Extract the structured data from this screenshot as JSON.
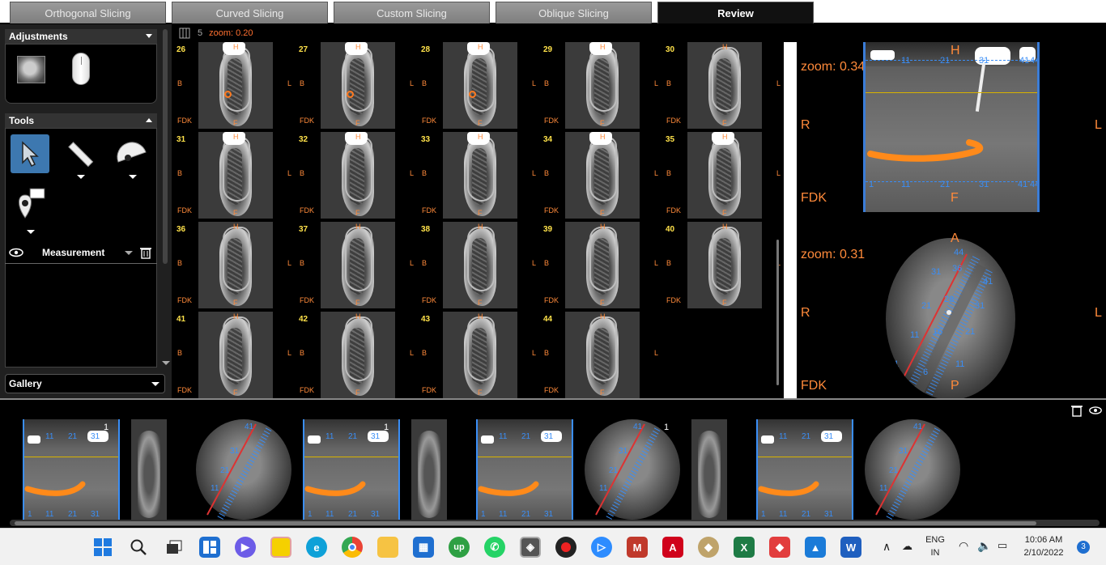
{
  "tabs": [
    {
      "label": "Orthogonal Slicing",
      "active": false
    },
    {
      "label": "Curved Slicing",
      "active": false
    },
    {
      "label": "Custom Slicing",
      "active": false
    },
    {
      "label": "Oblique Slicing",
      "active": false
    },
    {
      "label": "Review",
      "active": true
    }
  ],
  "left_panel": {
    "adjustments_title": "Adjustments",
    "tools_title": "Tools",
    "measurement_label": "Measurement",
    "gallery_label": "Gallery"
  },
  "grid": {
    "layout_count": "5",
    "zoom_label": "zoom: 0.20",
    "orientation_labels": {
      "top": "H",
      "bottom": "F",
      "left": "B",
      "right": "L",
      "corner": "FDK"
    },
    "slices": [
      "26",
      "27",
      "28",
      "29",
      "30",
      "31",
      "32",
      "33",
      "34",
      "35",
      "36",
      "37",
      "38",
      "39",
      "40",
      "41",
      "42",
      "43",
      "44"
    ]
  },
  "right_view": {
    "upper": {
      "zoom": "zoom: 0.34",
      "left": "R",
      "right": "L",
      "corner": "FDK",
      "top_marker": "H",
      "bottom_marker": "F",
      "top_ticks": [
        "1",
        "11",
        "21",
        "31",
        "41",
        "44"
      ],
      "bottom_ticks": [
        "1",
        "11",
        "21",
        "31",
        "41",
        "44"
      ]
    },
    "lower": {
      "zoom": "zoom: 0.31",
      "left": "R",
      "right": "L",
      "corner": "FDK",
      "top_marker": "A",
      "bottom_marker": "P",
      "ticks": [
        "44",
        "41",
        "31",
        "36",
        "21",
        "26",
        "11",
        "16",
        "1",
        "6",
        "1",
        "11",
        "21",
        "31",
        "41",
        "31"
      ]
    }
  },
  "gallery": {
    "items": [
      {
        "type": "pano"
      },
      {
        "type": "slice",
        "label": "1"
      },
      {
        "type": "axial"
      },
      {
        "type": "pano"
      },
      {
        "type": "slice",
        "label": "1"
      },
      {
        "type": "pano"
      },
      {
        "type": "axial"
      },
      {
        "type": "slice",
        "label": "1"
      },
      {
        "type": "pano"
      },
      {
        "type": "axial"
      }
    ],
    "tick_labels": [
      "11",
      "21",
      "31",
      "41",
      "1",
      "11",
      "21",
      "31",
      "41"
    ]
  },
  "taskbar": {
    "language": "ENG",
    "region": "IN",
    "time": "10:06 AM",
    "date": "2/10/2022",
    "notification_count": "3"
  },
  "colors": {
    "accent_orange": "#ff7a20",
    "slice_number_yellow": "#ffe24a",
    "ruler_blue": "#3a8ef6",
    "selected_tool_blue": "#3d78b0"
  }
}
